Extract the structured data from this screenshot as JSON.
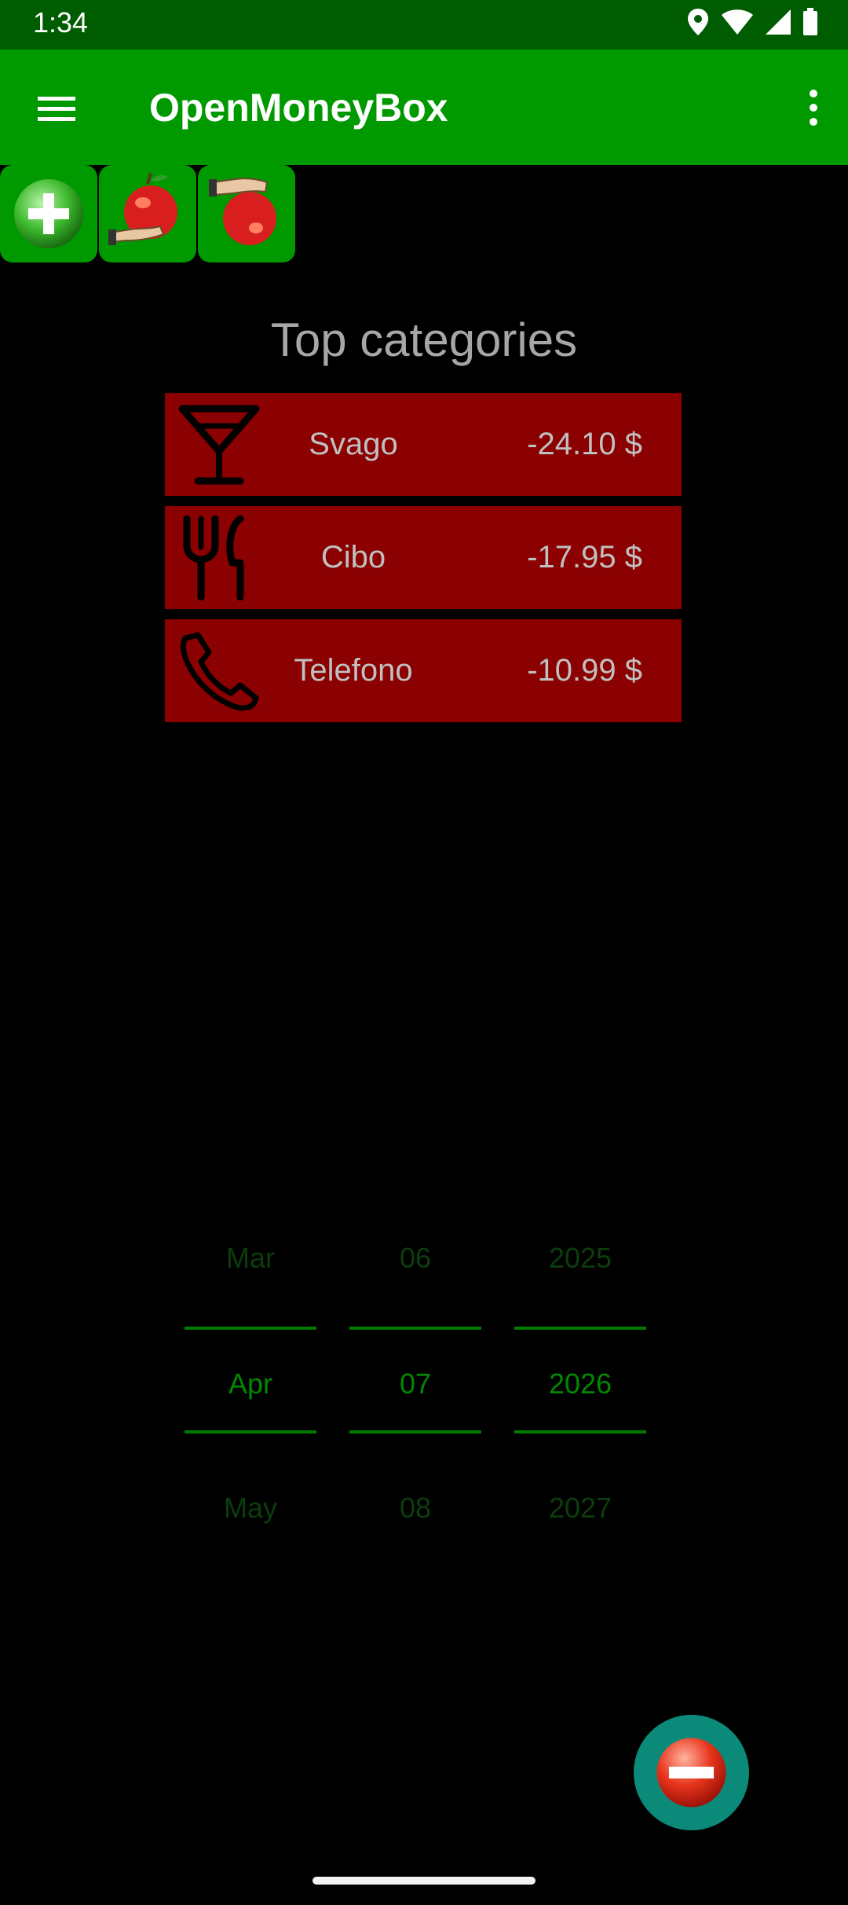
{
  "status_bar": {
    "time": "1:34",
    "icons": [
      "location-icon",
      "wifi-icon",
      "signal-icon",
      "battery-icon"
    ]
  },
  "app_bar": {
    "title": "OpenMoneyBox",
    "menu_icon": "hamburger-menu-icon",
    "overflow_icon": "more-vert-icon"
  },
  "quick_actions": [
    {
      "name": "add-operation",
      "icon": "plus-circle-icon"
    },
    {
      "name": "receive-money",
      "icon": "apple-receive-icon"
    },
    {
      "name": "give-money",
      "icon": "apple-give-icon"
    }
  ],
  "top_categories": {
    "title": "Top categories",
    "items": [
      {
        "name": "Svago",
        "amount": "-24.10 $",
        "icon": "cocktail-icon"
      },
      {
        "name": "Cibo",
        "amount": "-17.95 $",
        "icon": "fork-knife-icon"
      },
      {
        "name": "Telefono",
        "amount": "-10.99 $",
        "icon": "phone-icon"
      }
    ]
  },
  "date_picker": {
    "month": {
      "prev": "Mar",
      "current": "Apr",
      "next": "May"
    },
    "day": {
      "prev": "06",
      "current": "07",
      "next": "08"
    },
    "year": {
      "prev": "2025",
      "current": "2026",
      "next": "2027"
    }
  },
  "fab": {
    "icon": "minus-circle-icon"
  },
  "colors": {
    "app_bar": "#009900",
    "status_bar": "#005c00",
    "category_row": "#8b0000",
    "fab": "#0b8a7a"
  }
}
